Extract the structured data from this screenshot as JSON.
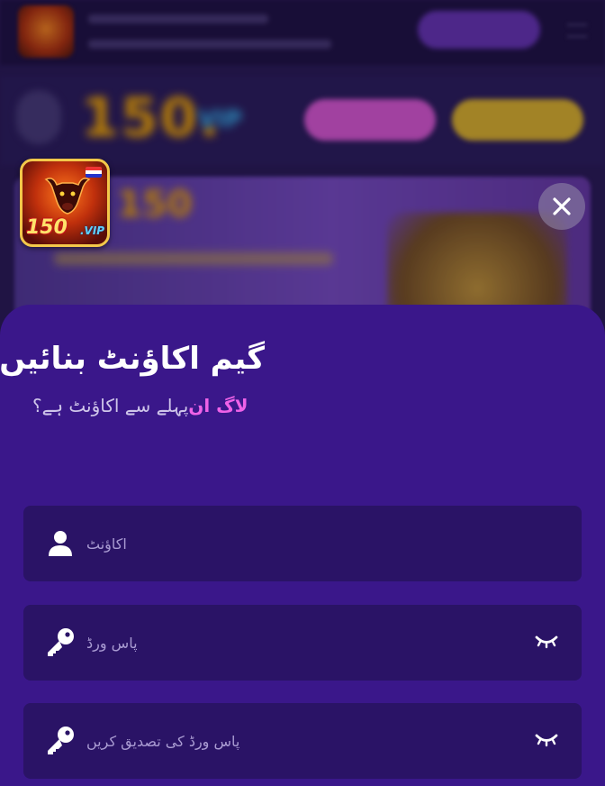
{
  "register_modal": {
    "title": "گیم اکاؤنٹ بنائیں",
    "subtitle": "پہلے سے اکاؤنٹ ہے؟",
    "login_link": "لاگ ان",
    "fields": {
      "account": {
        "placeholder": "اکاؤنٹ",
        "icon": "user-icon"
      },
      "password": {
        "placeholder": "پاس ورڈ",
        "icon": "key-icon",
        "toggle_icon": "eye-closed-icon"
      },
      "confirm_password": {
        "placeholder": "پاس ورڈ کی تصدیق کریں",
        "icon": "key-icon",
        "toggle_icon": "eye-closed-icon"
      }
    },
    "close_icon": "close-icon"
  },
  "game_logo": {
    "number": "150",
    "suffix": ".VIP"
  },
  "colors": {
    "sheet_bg": "#3a178a",
    "field_bg": "#2a1366",
    "link": "#ef62e8",
    "logo_border": "#f3c84a"
  }
}
